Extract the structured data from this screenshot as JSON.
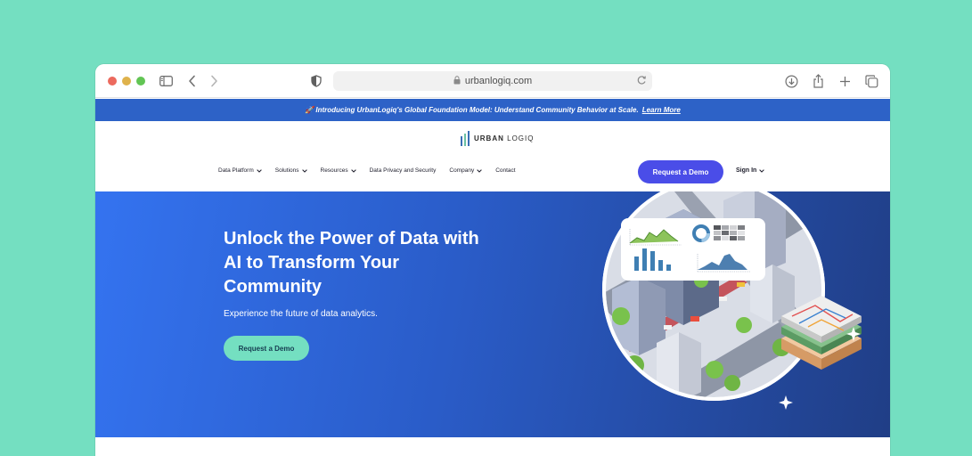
{
  "browser": {
    "url": "urbanlogiq.com",
    "icons": [
      "sidebar-icon",
      "back-icon",
      "forward-icon",
      "shield-icon",
      "lock-icon",
      "reload-icon",
      "download-icon",
      "share-icon",
      "new-tab-icon",
      "tabs-overview-icon"
    ]
  },
  "announcement": {
    "text": "🚀 Introducing UrbanLogiq's Global Foundation Model: Understand Community Behavior at Scale.",
    "link": "Learn More"
  },
  "logo": {
    "word1": "URBAN",
    "word2": "LOGIQ"
  },
  "nav": {
    "items": [
      {
        "label": "Data Platform",
        "dropdown": true
      },
      {
        "label": "Solutions",
        "dropdown": true
      },
      {
        "label": "Resources",
        "dropdown": true
      },
      {
        "label": "Data Privacy and Security",
        "dropdown": false
      },
      {
        "label": "Company",
        "dropdown": true
      },
      {
        "label": "Contact",
        "dropdown": false
      }
    ],
    "cta": "Request a Demo",
    "signin": "Sign In"
  },
  "hero": {
    "title": "Unlock the Power of Data with AI to Transform Your Community",
    "subtitle": "Experience the future of data analytics.",
    "cta": "Request a Demo"
  },
  "colors": {
    "page_bg": "#74dfc1",
    "announce_bg": "#2d62c7",
    "primary_button": "#4a4de8",
    "hero_button": "#74dfc1",
    "hero_gradient_start": "#3473f0",
    "hero_gradient_end": "#203e86"
  }
}
